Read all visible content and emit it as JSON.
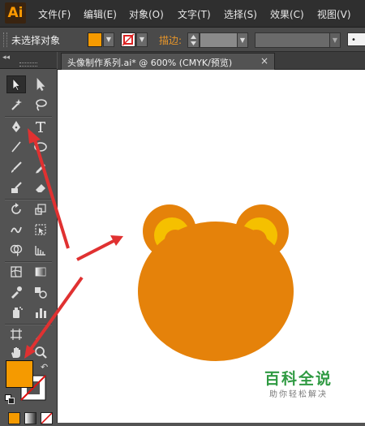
{
  "app": {
    "logo": "Ai"
  },
  "menu": {
    "items": [
      "文件(F)",
      "编辑(E)",
      "对象(O)",
      "文字(T)",
      "选择(S)",
      "效果(C)",
      "视图(V)"
    ]
  },
  "control_bar": {
    "selection_status": "未选择对象",
    "stroke_label": "描边:",
    "fill_color": "#f59a00",
    "brush_value": "•"
  },
  "document": {
    "tab_title": "头像制作系列.ai* @ 600% (CMYK/预览)",
    "close_glyph": "×"
  },
  "tools_panel": {
    "collapse_glyph": "◂◂",
    "fill_color": "#f59a00",
    "swap_glyph": "↶",
    "tools": [
      "selection-tool",
      "direct-selection-tool",
      "magic-wand-tool",
      "lasso-tool",
      "pen-tool",
      "type-tool",
      "line-tool",
      "ellipse-tool",
      "paintbrush-tool",
      "pencil-tool",
      "blob-brush-tool",
      "eraser-tool",
      "rotate-tool",
      "scale-tool",
      "warp-tool",
      "free-transform-tool",
      "shape-builder-tool",
      "graph-tool",
      "mesh-tool",
      "gradient-tool",
      "eyedropper-tool",
      "blend-tool",
      "symbol-sprayer-tool",
      "column-graph-tool",
      "artboard-tool",
      "slice-tool",
      "hand-tool",
      "zoom-tool"
    ]
  },
  "artwork": {
    "face_color": "#e5820a",
    "ear_inner_color": "#f5c000"
  },
  "watermark": {
    "title": "百科全说",
    "subtitle": "助你轻松解决"
  },
  "annotation": {
    "arrow_color": "#e03131"
  }
}
